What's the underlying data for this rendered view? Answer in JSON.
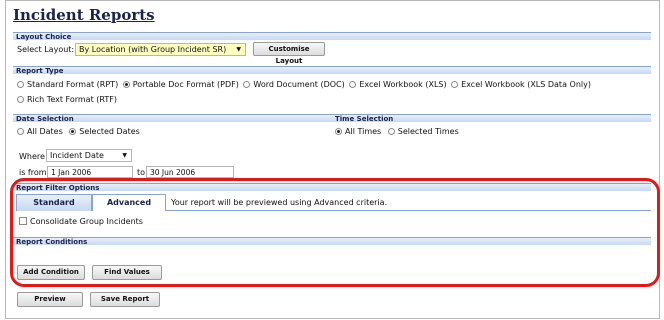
{
  "page_title": "Incident Reports",
  "layout_choice": {
    "section_title": "Layout Choice",
    "select_label": "Select Layout:",
    "select_value": "By Location (with Group Incident SR)",
    "customise_button": "Customise Layout"
  },
  "report_type": {
    "section_title": "Report Type",
    "options": [
      {
        "label": "Standard Format (RPT)",
        "selected": false
      },
      {
        "label": "Portable Doc Format (PDF)",
        "selected": true
      },
      {
        "label": "Word Document (DOC)",
        "selected": false
      },
      {
        "label": "Excel Workbook (XLS)",
        "selected": false
      },
      {
        "label": "Excel Workbook (XLS Data Only)",
        "selected": false
      },
      {
        "label": "Rich Text Format (RTF)",
        "selected": false
      }
    ]
  },
  "date_selection": {
    "section_title": "Date Selection",
    "all_dates": "All Dates",
    "selected_dates": "Selected Dates",
    "where_label": "Where",
    "where_value": "Incident Date",
    "is_from_label": "is from",
    "from_value": "1 Jan 2006",
    "to_label": "to",
    "to_value": "30 Jun 2006"
  },
  "time_selection": {
    "section_title": "Time Selection",
    "all_times": "All Times",
    "selected_times": "Selected Times"
  },
  "report_filter": {
    "section_title": "Report Filter Options",
    "tab_standard": "Standard",
    "tab_advanced": "Advanced",
    "preview_note": "Your report will be previewed using Advanced criteria.",
    "consolidate_label": "Consolidate Group Incidents"
  },
  "report_conditions": {
    "section_title": "Report Conditions",
    "add_condition": "Add Condition",
    "find_values": "Find Values"
  },
  "footer": {
    "preview": "Preview",
    "save_report": "Save Report"
  },
  "colors": {
    "title": "#1a2250",
    "section_bar": "#c9d9f2",
    "highlight": "#e31818",
    "select_highlight": "#ffffc0"
  }
}
